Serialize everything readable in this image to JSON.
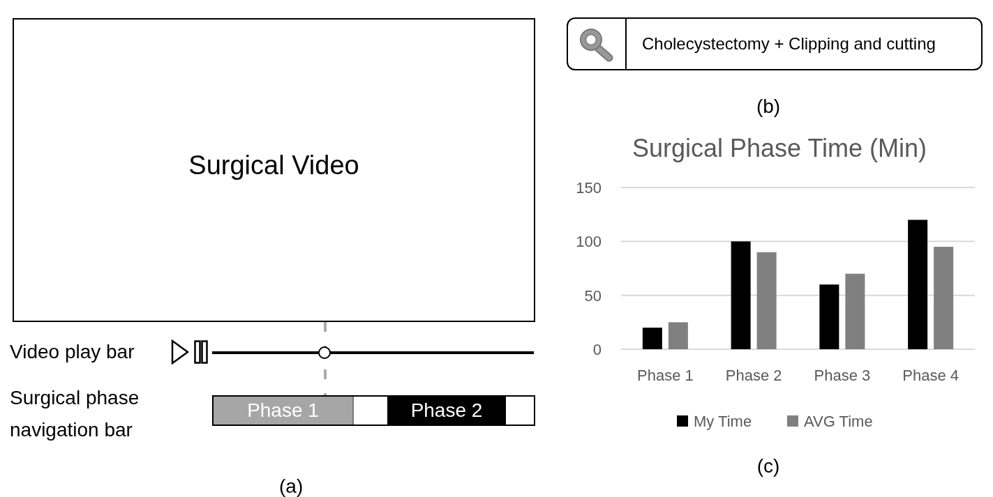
{
  "video_panel": {
    "video_label": "Surgical Video",
    "play_bar": {
      "label": "Video play bar",
      "level": 0.35
    },
    "phase_nav": {
      "label": "Surgical phase navigation bar",
      "segments": [
        {
          "kind": "phase",
          "label": "Phase 1",
          "color": "#a6a6a6"
        },
        {
          "kind": "gap"
        },
        {
          "kind": "phase",
          "label": "Phase 2",
          "color": "#000000"
        },
        {
          "kind": "gap"
        }
      ]
    },
    "caption": "(a)"
  },
  "search_panel": {
    "value": "Cholecystectomy + Clipping and cutting",
    "caption": "(b)"
  },
  "chart_panel": {
    "chart_data": {
      "type": "bar",
      "title": "Surgical Phase Time (Min)",
      "categories": [
        "Phase 1",
        "Phase 2",
        "Phase 3",
        "Phase 4"
      ],
      "series": [
        {
          "name": "My Time",
          "color": "#000000",
          "values": [
            20,
            100,
            60,
            120
          ]
        },
        {
          "name": "AVG Time",
          "color": "#808080",
          "values": [
            25,
            90,
            70,
            95
          ]
        }
      ],
      "ylim": [
        0,
        150
      ],
      "yticks": [
        0,
        50,
        100,
        150
      ],
      "legend": true
    },
    "caption": "(c)"
  }
}
